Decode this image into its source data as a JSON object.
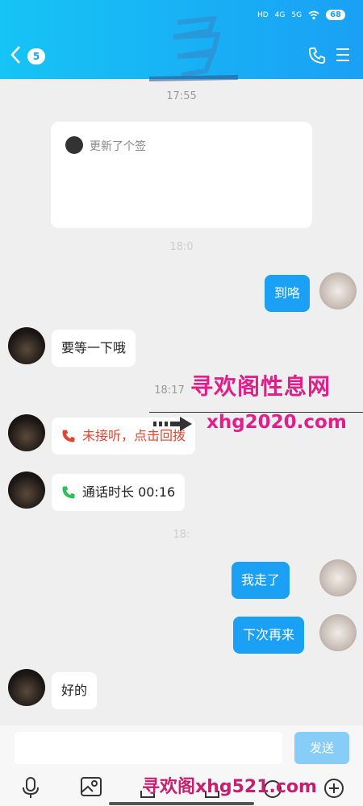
{
  "status_bar": {
    "hd": "HD",
    "net1": "4G",
    "net2": "5G",
    "battery": "68"
  },
  "header": {
    "unread_count": "5"
  },
  "messages": {
    "time1": "17:55",
    "card_text": "更新了个签",
    "time2": "18:0",
    "out1": "到咯",
    "in1": "要等一下哦",
    "time3": "18:17",
    "missed_call": "未接听，点击回拨",
    "call_duration": "通话时长 00:16",
    "time4": "18:",
    "out2": "我走了",
    "out3": "下次再来",
    "in2": "好的"
  },
  "watermarks": {
    "cn": "寻欢阁性息网",
    "url": "xhg2020.com",
    "bottom": "寻欢阁xhg521.com"
  },
  "input": {
    "send_label": "发送"
  },
  "colors": {
    "header": "#1aa0f5",
    "outgoing": "#1aa0f5",
    "missed_call": "#e2442f",
    "call_ok": "#2cbf5a"
  }
}
